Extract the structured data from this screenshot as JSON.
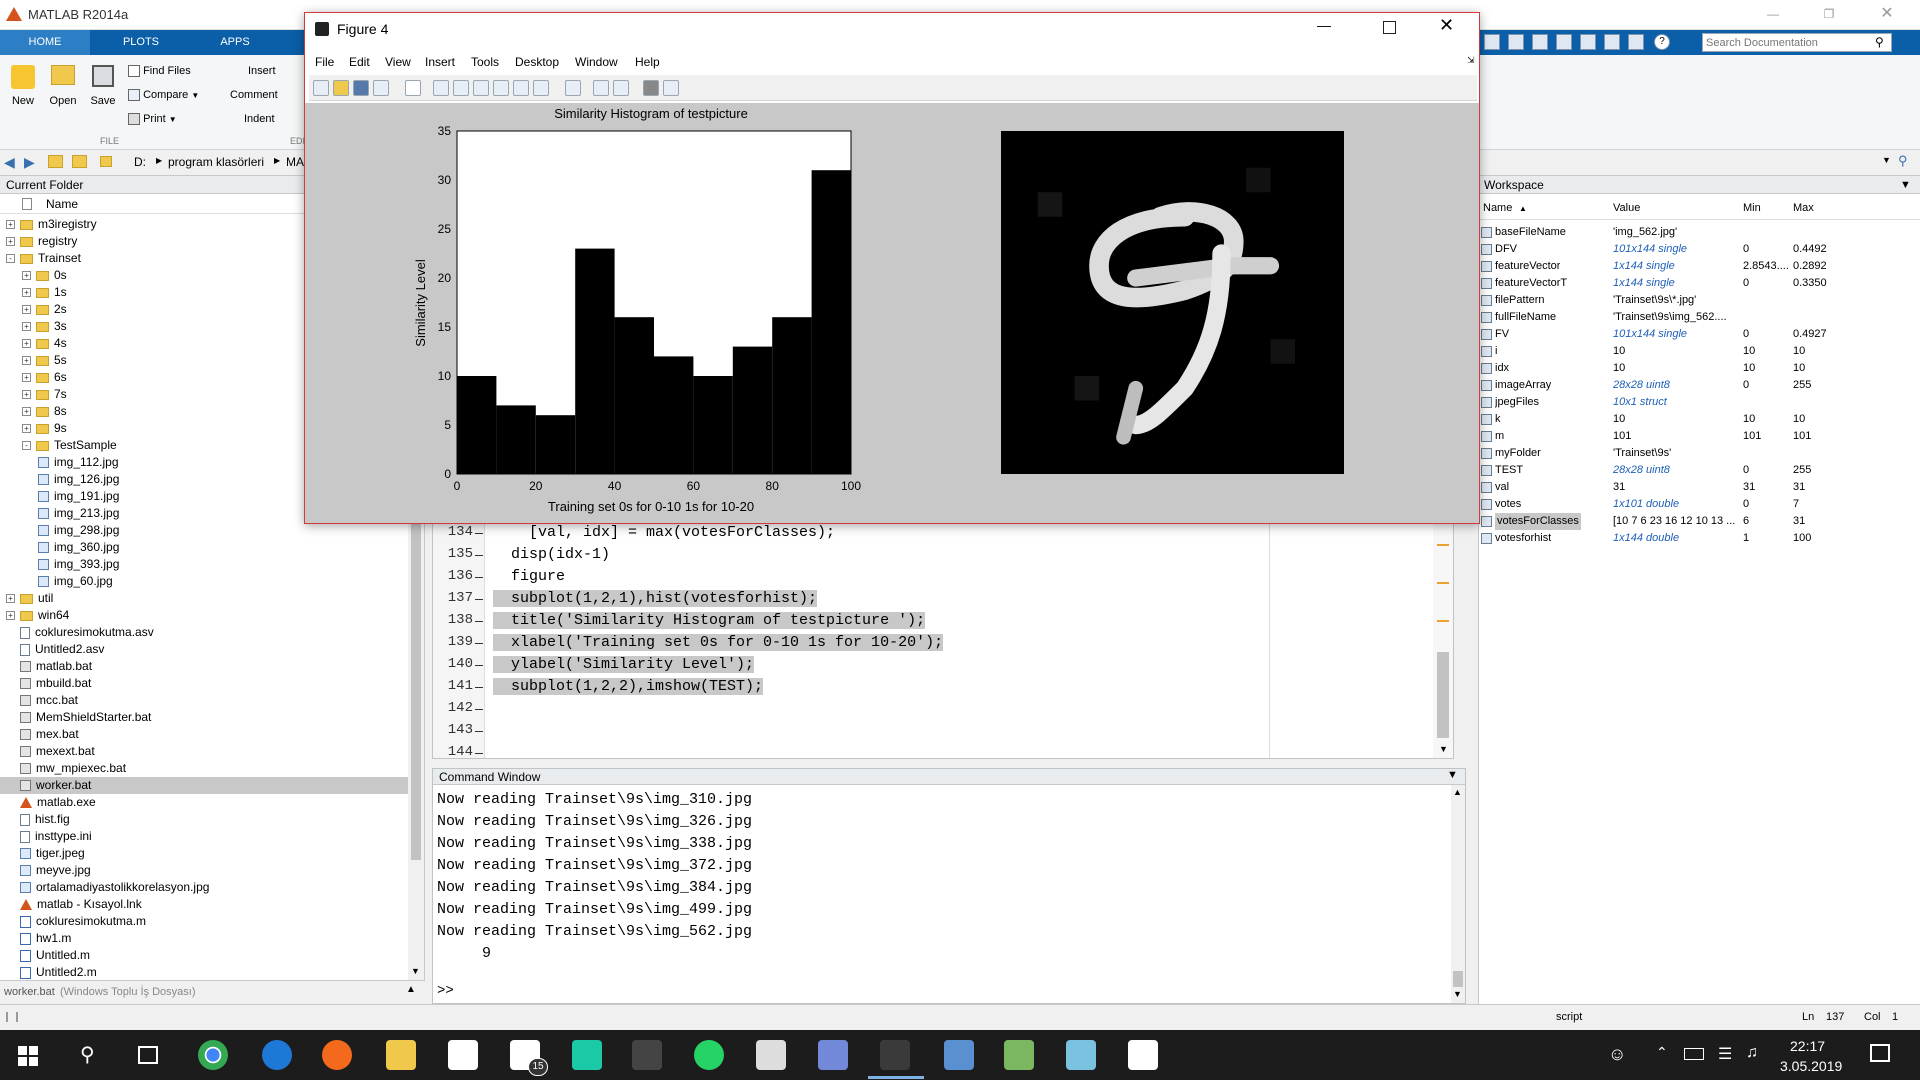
{
  "app": {
    "title": "MATLAB R2014a",
    "search_placeholder": "Search Documentation"
  },
  "ribbon": {
    "tabs": [
      "HOME",
      "PLOTS",
      "APPS"
    ],
    "new": "New",
    "open": "Open",
    "save": "Save",
    "find_files": "Find Files",
    "compare": "Compare",
    "print": "Print",
    "insert": "Insert",
    "comment": "Comment",
    "indent": "Indent",
    "file_group": "FILE",
    "edit_group": "EDI"
  },
  "address": {
    "parts": [
      "D:",
      "program klasörleri",
      "MA"
    ]
  },
  "folder": {
    "title": "Current Folder",
    "name_header": "Name",
    "items": [
      {
        "label": "m3iregistry",
        "kind": "folder",
        "level": 0,
        "exp": "+"
      },
      {
        "label": "registry",
        "kind": "folder",
        "level": 0,
        "exp": "+"
      },
      {
        "label": "Trainset",
        "kind": "folder",
        "level": 0,
        "exp": "-"
      },
      {
        "label": "0s",
        "kind": "folder",
        "level": 1,
        "exp": "+"
      },
      {
        "label": "1s",
        "kind": "folder",
        "level": 1,
        "exp": "+"
      },
      {
        "label": "2s",
        "kind": "folder",
        "level": 1,
        "exp": "+"
      },
      {
        "label": "3s",
        "kind": "folder",
        "level": 1,
        "exp": "+"
      },
      {
        "label": "4s",
        "kind": "folder",
        "level": 1,
        "exp": "+"
      },
      {
        "label": "5s",
        "kind": "folder",
        "level": 1,
        "exp": "+"
      },
      {
        "label": "6s",
        "kind": "folder",
        "level": 1,
        "exp": "+"
      },
      {
        "label": "7s",
        "kind": "folder",
        "level": 1,
        "exp": "+"
      },
      {
        "label": "8s",
        "kind": "folder",
        "level": 1,
        "exp": "+"
      },
      {
        "label": "9s",
        "kind": "folder",
        "level": 1,
        "exp": "+"
      },
      {
        "label": "TestSample",
        "kind": "folder",
        "level": 1,
        "exp": "-"
      },
      {
        "label": "img_112.jpg",
        "kind": "img",
        "level": 2
      },
      {
        "label": "img_126.jpg",
        "kind": "img",
        "level": 2
      },
      {
        "label": "img_191.jpg",
        "kind": "img",
        "level": 2
      },
      {
        "label": "img_213.jpg",
        "kind": "img",
        "level": 2
      },
      {
        "label": "img_298.jpg",
        "kind": "img",
        "level": 2
      },
      {
        "label": "img_360.jpg",
        "kind": "img",
        "level": 2
      },
      {
        "label": "img_393.jpg",
        "kind": "img",
        "level": 2
      },
      {
        "label": "img_60.jpg",
        "kind": "img",
        "level": 2
      },
      {
        "label": "util",
        "kind": "folder",
        "level": 0,
        "exp": "+"
      },
      {
        "label": "win64",
        "kind": "folder",
        "level": 0,
        "exp": "+"
      },
      {
        "label": "cokluresimokutma.asv",
        "kind": "file",
        "level": 0
      },
      {
        "label": "Untitled2.asv",
        "kind": "file",
        "level": 0
      },
      {
        "label": "matlab.bat",
        "kind": "bat",
        "level": 0
      },
      {
        "label": "mbuild.bat",
        "kind": "bat",
        "level": 0
      },
      {
        "label": "mcc.bat",
        "kind": "bat",
        "level": 0
      },
      {
        "label": "MemShieldStarter.bat",
        "kind": "bat",
        "level": 0
      },
      {
        "label": "mex.bat",
        "kind": "bat",
        "level": 0
      },
      {
        "label": "mexext.bat",
        "kind": "bat",
        "level": 0
      },
      {
        "label": "mw_mpiexec.bat",
        "kind": "bat",
        "level": 0
      },
      {
        "label": "worker.bat",
        "kind": "bat",
        "level": 0,
        "selected": true
      },
      {
        "label": "matlab.exe",
        "kind": "matlab",
        "level": 0
      },
      {
        "label": "hist.fig",
        "kind": "file",
        "level": 0
      },
      {
        "label": "insttype.ini",
        "kind": "file",
        "level": 0
      },
      {
        "label": "tiger.jpeg",
        "kind": "img",
        "level": 0
      },
      {
        "label": "meyve.jpg",
        "kind": "img",
        "level": 0
      },
      {
        "label": "ortalamadiyastolikkorelasyon.jpg",
        "kind": "img",
        "level": 0
      },
      {
        "label": "matlab - Kısayol.lnk",
        "kind": "matlab",
        "level": 0
      },
      {
        "label": "cokluresimokutma.m",
        "kind": "m",
        "level": 0
      },
      {
        "label": "hw1.m",
        "kind": "m",
        "level": 0
      },
      {
        "label": "Untitled.m",
        "kind": "m",
        "level": 0
      },
      {
        "label": "Untitled2.m",
        "kind": "m",
        "level": 0
      }
    ],
    "details": "worker.bat",
    "details_type": "(Windows Toplu İş Dosyası)"
  },
  "editor": {
    "lines": [
      {
        "n": "134",
        "text": "    [val, idx] = max(votesForClasses);",
        "hl": false
      },
      {
        "n": "135",
        "text": "  disp(idx-1)",
        "hl": false
      },
      {
        "n": "136",
        "text": "  figure",
        "hl": false
      },
      {
        "n": "137",
        "text": "  subplot(1,2,1),hist(votesforhist);",
        "hl": true
      },
      {
        "n": "138",
        "text": "  title('Similarity Histogram of testpicture ');",
        "hl": true
      },
      {
        "n": "139",
        "text": "  xlabel('Training set 0s for 0-10 1s for 10-20');",
        "hl": true
      },
      {
        "n": "140",
        "text": "  ylabel('Similarity Level');",
        "hl": true
      },
      {
        "n": "141",
        "text": "  subplot(1,2,2),imshow(TEST);",
        "hl": true
      },
      {
        "n": "142",
        "text": "",
        "hl": false
      },
      {
        "n": "143",
        "text": "",
        "hl": false
      },
      {
        "n": "144",
        "text": "",
        "hl": false
      }
    ]
  },
  "command": {
    "title": "Command Window",
    "lines": [
      "Now reading Trainset\\9s\\img_310.jpg",
      "Now reading Trainset\\9s\\img_326.jpg",
      "Now reading Trainset\\9s\\img_338.jpg",
      "Now reading Trainset\\9s\\img_372.jpg",
      "Now reading Trainset\\9s\\img_384.jpg",
      "Now reading Trainset\\9s\\img_499.jpg",
      "Now reading Trainset\\9s\\img_562.jpg",
      "     9"
    ],
    "prompt": ">>"
  },
  "workspace": {
    "title": "Workspace",
    "headers": {
      "name": "Name",
      "value": "Value",
      "min": "Min",
      "max": "Max"
    },
    "vars": [
      {
        "name": "baseFileName",
        "value": "'img_562.jpg'",
        "min": "",
        "max": "",
        "blue": false
      },
      {
        "name": "DFV",
        "value": "101x144 single",
        "min": "0",
        "max": "0.4492",
        "blue": true
      },
      {
        "name": "featureVector",
        "value": "1x144 single",
        "min": "2.8543....",
        "max": "0.2892",
        "blue": true
      },
      {
        "name": "featureVectorT",
        "value": "1x144 single",
        "min": "0",
        "max": "0.3350",
        "blue": true
      },
      {
        "name": "filePattern",
        "value": "'Trainset\\9s\\*.jpg'",
        "min": "",
        "max": "",
        "blue": false
      },
      {
        "name": "fullFileName",
        "value": "'Trainset\\9s\\img_562....",
        "min": "",
        "max": "",
        "blue": false
      },
      {
        "name": "FV",
        "value": "101x144 single",
        "min": "0",
        "max": "0.4927",
        "blue": true
      },
      {
        "name": "i",
        "value": "10",
        "min": "10",
        "max": "10",
        "blue": false
      },
      {
        "name": "idx",
        "value": "10",
        "min": "10",
        "max": "10",
        "blue": false
      },
      {
        "name": "imageArray",
        "value": "28x28 uint8",
        "min": "0",
        "max": "255",
        "blue": true
      },
      {
        "name": "jpegFiles",
        "value": "10x1 struct",
        "min": "",
        "max": "",
        "blue": true
      },
      {
        "name": "k",
        "value": "10",
        "min": "10",
        "max": "10",
        "blue": false
      },
      {
        "name": "m",
        "value": "101",
        "min": "101",
        "max": "101",
        "blue": false
      },
      {
        "name": "myFolder",
        "value": "'Trainset\\9s'",
        "min": "",
        "max": "",
        "blue": false
      },
      {
        "name": "TEST",
        "value": "28x28 uint8",
        "min": "0",
        "max": "255",
        "blue": true
      },
      {
        "name": "val",
        "value": "31",
        "min": "31",
        "max": "31",
        "blue": false
      },
      {
        "name": "votes",
        "value": "1x101 double",
        "min": "0",
        "max": "7",
        "blue": true
      },
      {
        "name": "votesForClasses",
        "value": "[10 7 6 23 16 12 10 13 ...",
        "min": "6",
        "max": "31",
        "blue": false,
        "selected": true
      },
      {
        "name": "votesforhist",
        "value": "1x144 double",
        "min": "1",
        "max": "100",
        "blue": true
      }
    ]
  },
  "figure": {
    "title": "Figure 4",
    "menu": [
      "File",
      "Edit",
      "View",
      "Insert",
      "Tools",
      "Desktop",
      "Window",
      "Help"
    ]
  },
  "chart_data": {
    "type": "bar",
    "title": "Similarity Histogram of testpicture",
    "xlabel": "Training set 0s for 0-10 1s for 10-20",
    "ylabel": "Similarity Level",
    "bin_edges": [
      0,
      10,
      20,
      30,
      40,
      50,
      60,
      70,
      80,
      90,
      100
    ],
    "values": [
      10,
      7,
      6,
      23,
      16,
      12,
      10,
      13,
      16,
      31
    ],
    "xlim": [
      0,
      100
    ],
    "ylim": [
      0,
      35
    ],
    "xticks": [
      "0",
      "20",
      "40",
      "60",
      "80",
      "100"
    ],
    "yticks": [
      "0",
      "5",
      "10",
      "15",
      "20",
      "25",
      "30",
      "35"
    ]
  },
  "status": {
    "script": "script",
    "ln_label": "Ln",
    "ln": "137",
    "col_label": "Col",
    "col": "1"
  },
  "taskbar": {
    "time": "22:17",
    "date": "3.05.2019",
    "badge": "15"
  }
}
